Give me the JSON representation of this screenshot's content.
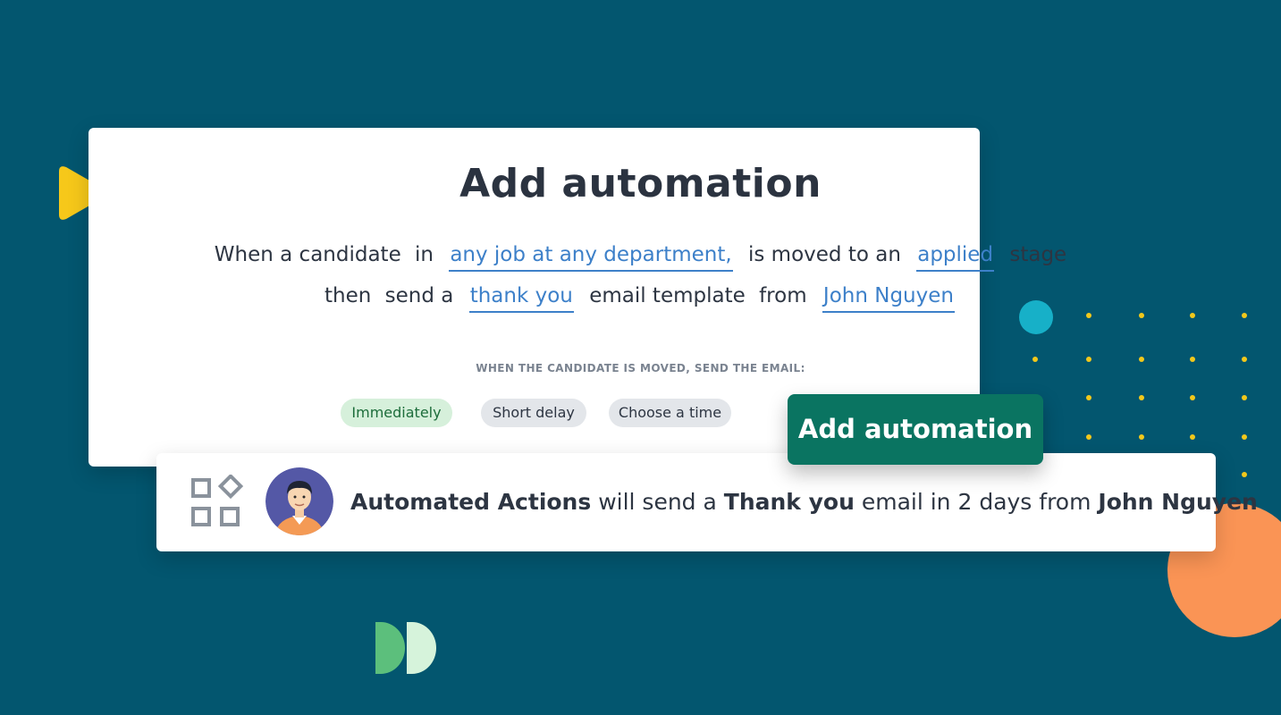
{
  "card": {
    "title": "Add automation",
    "line1": {
      "w1": "When a candidate",
      "w2": "in",
      "link_job": "any job at any department,",
      "w3": "is moved to an",
      "link_stage": "applied",
      "w4": "stage"
    },
    "line2": {
      "w1": "then",
      "w2": "send a",
      "link_template": "thank you",
      "w3": "email template",
      "w4": "from",
      "link_sender": "John Nguyen"
    },
    "timing_label": "WHEN THE CANDIDATE IS MOVED, SEND THE EMAIL:",
    "timing_options": [
      "Immediately",
      "Short delay",
      "Choose a time"
    ],
    "selected_option": "Immediately"
  },
  "add_button_label": "Add automation",
  "summary": {
    "actor": "Automated Actions",
    "t1": " will send a ",
    "template": "Thank you",
    "t2": " email in 2 days from ",
    "sender": "John Nguyen"
  },
  "colors": {
    "background": "#03566f",
    "link": "#3d80c9",
    "button": "#0a7461",
    "selected_pill": "#d6f0db",
    "accent_yellow": "#f2c81b",
    "accent_orange": "#fa9455",
    "accent_teal": "#17b0c8"
  },
  "icons": [
    "play-icon",
    "apps-grid-icon",
    "user-avatar",
    "brand-logo-icon"
  ]
}
